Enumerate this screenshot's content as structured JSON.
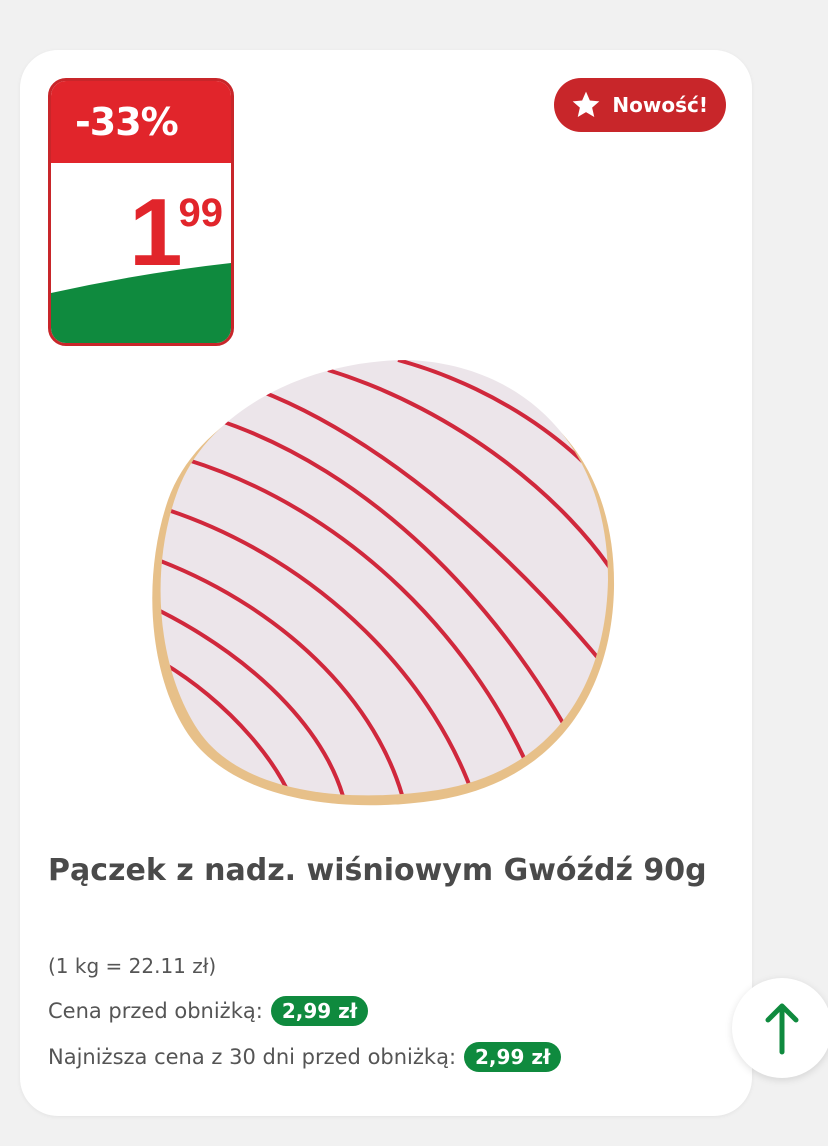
{
  "product": {
    "discount_label": "-33%",
    "price_integer": "1",
    "price_decimal": "99",
    "badge_label": "Nowość!",
    "title": "Pączek z nadz. wiśniowym Gwóźdź 90g",
    "unit_price": "(1 kg = 22.11 zł)",
    "previous_price_label": "Cena przed obniżką:",
    "previous_price": "2,99 zł",
    "lowest_price_label": "Najniższa cena z 30 dni przed obniżką:",
    "lowest_price": "2,99 zł"
  },
  "icons": {
    "badge": "star-icon",
    "scroll": "arrow-up-icon"
  },
  "colors": {
    "brand_red": "#e1252b",
    "brand_green": "#0f8a3e"
  }
}
